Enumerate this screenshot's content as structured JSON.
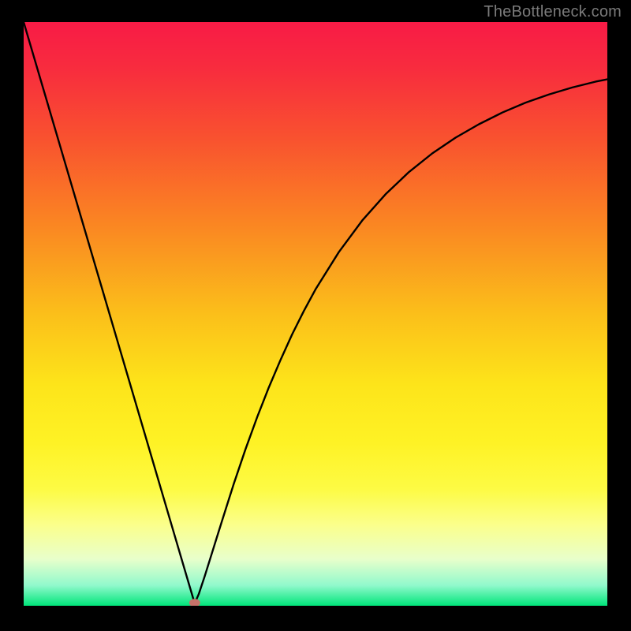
{
  "attribution": "TheBottleneck.com",
  "chart_data": {
    "type": "line",
    "title": "",
    "xlabel": "",
    "ylabel": "",
    "xlim": [
      0,
      100
    ],
    "ylim": [
      0,
      100
    ],
    "gradient_stops": [
      {
        "offset": 0,
        "color": "#f81b46"
      },
      {
        "offset": 0.08,
        "color": "#f82c3e"
      },
      {
        "offset": 0.2,
        "color": "#f9522f"
      },
      {
        "offset": 0.35,
        "color": "#fa8722"
      },
      {
        "offset": 0.5,
        "color": "#fbbf1a"
      },
      {
        "offset": 0.62,
        "color": "#fde41a"
      },
      {
        "offset": 0.72,
        "color": "#fef225"
      },
      {
        "offset": 0.8,
        "color": "#fdfb44"
      },
      {
        "offset": 0.86,
        "color": "#fbff8a"
      },
      {
        "offset": 0.92,
        "color": "#e8ffcb"
      },
      {
        "offset": 0.965,
        "color": "#91f9cc"
      },
      {
        "offset": 1.0,
        "color": "#00e57a"
      }
    ],
    "x": [
      0,
      2,
      4,
      6,
      8,
      10,
      12,
      14,
      16,
      18,
      20,
      22,
      24,
      26,
      28,
      29.3,
      30,
      31,
      32,
      33,
      34,
      36,
      38,
      40,
      42,
      44,
      46,
      48,
      50,
      54,
      58,
      62,
      66,
      70,
      74,
      78,
      82,
      86,
      90,
      94,
      98,
      100
    ],
    "values": [
      100,
      93.2,
      86.4,
      79.6,
      72.8,
      66,
      59.2,
      52.4,
      45.6,
      38.8,
      32,
      25.2,
      18.4,
      11.6,
      4.8,
      0.4,
      2.0,
      5.0,
      8.2,
      11.4,
      14.6,
      20.9,
      26.8,
      32.3,
      37.4,
      42.1,
      46.5,
      50.5,
      54.2,
      60.6,
      66,
      70.5,
      74.3,
      77.5,
      80.2,
      82.5,
      84.5,
      86.2,
      87.6,
      88.8,
      89.8,
      90.2
    ],
    "marker": {
      "x": 29.3,
      "y": 0.5,
      "color": "#c5736a",
      "rx": 7,
      "ry": 5
    }
  }
}
